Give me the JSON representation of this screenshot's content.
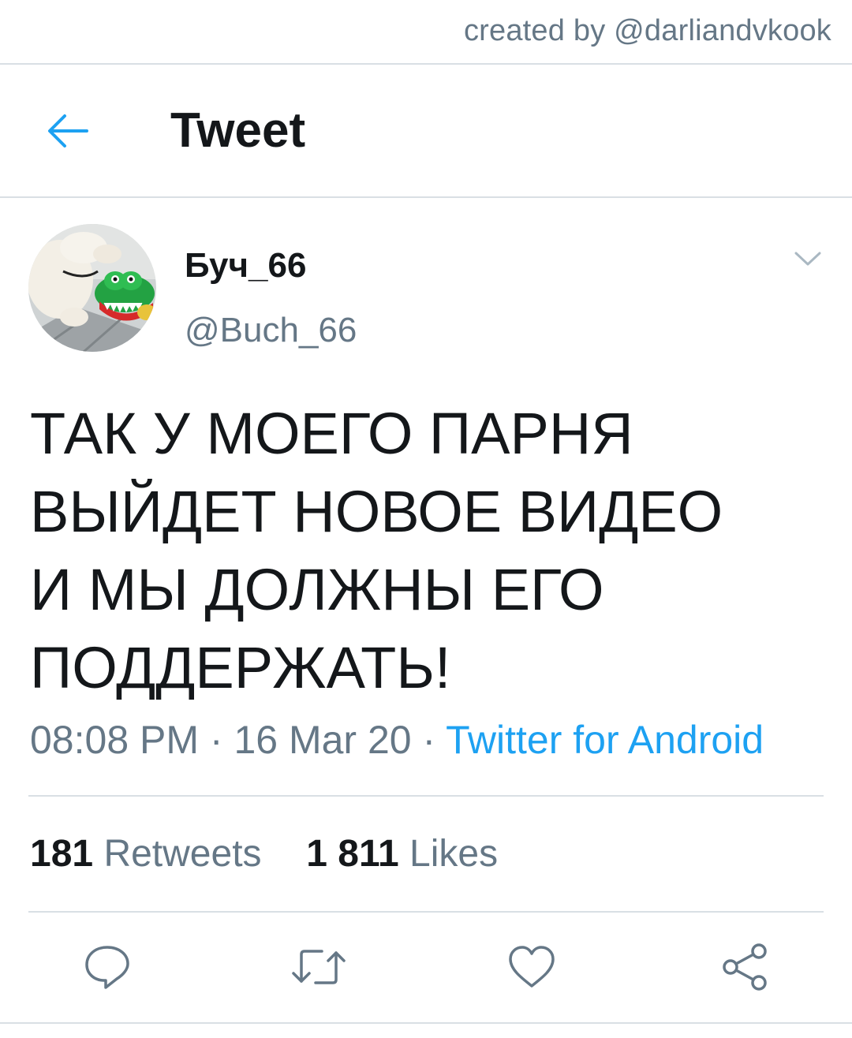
{
  "watermark": {
    "text": "created by @darliandvkook"
  },
  "header": {
    "back_icon": "arrow-left-icon",
    "title": "Tweet"
  },
  "tweet": {
    "author": {
      "name": "Буч_66",
      "handle": "@Buch_66",
      "avatar": "dog-with-crocodile-toy-photo"
    },
    "text_lines": [
      "ТАК У МОЕГО ПАРНЯ",
      "ВЫЙДЕТ НОВОЕ ВИДЕО",
      "И МЫ ДОЛЖНЫ ЕГО",
      "ПОДДЕРЖАТЬ!"
    ],
    "time": "08:08 PM",
    "separator": " · ",
    "date": "16 Mar 20",
    "source": "Twitter for Android",
    "stats": {
      "retweets_count": "181",
      "retweets_label": "Retweets",
      "likes_count": "1 811",
      "likes_label": "Likes"
    }
  },
  "actions": [
    {
      "icon": "reply-icon"
    },
    {
      "icon": "retweet-icon"
    },
    {
      "icon": "like-heart-icon"
    },
    {
      "icon": "share-icon"
    }
  ],
  "colors": {
    "accent": "#1da1f2",
    "text_primary": "#14171a",
    "text_secondary": "#657786",
    "divider": "#d9dfe4"
  }
}
